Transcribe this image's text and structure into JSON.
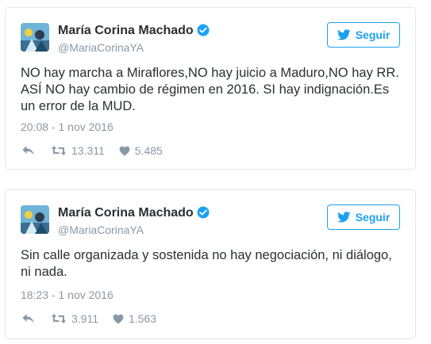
{
  "tweets": [
    {
      "name": "María Corina Machado",
      "handle": "@MariaCorinaYA",
      "follow_label": "Seguir",
      "text": "NO hay marcha a Miraflores,NO hay juicio a Maduro,NO hay RR. ASÍ NO hay cambio de régimen en 2016. SI hay indignación.Es un error de la MUD.",
      "timestamp": "20:08 - 1 nov 2016",
      "retweets": "13.311",
      "likes": "5.485"
    },
    {
      "name": "María Corina Machado",
      "handle": "@MariaCorinaYA",
      "follow_label": "Seguir",
      "text": "Sin calle organizada y sostenida no hay negociación, ni diálogo, ni nada.",
      "timestamp": "18:23 - 1 nov 2016",
      "retweets": "3.911",
      "likes": "1.563"
    }
  ],
  "icons": {
    "verified": "verified-badge-icon",
    "bird": "twitter-bird-icon",
    "reply": "reply-icon",
    "retweet": "retweet-icon",
    "like": "heart-icon"
  },
  "colors": {
    "accent": "#1da1f2",
    "muted": "#8899a6",
    "text": "#292f33",
    "border": "#e1e8ed"
  }
}
